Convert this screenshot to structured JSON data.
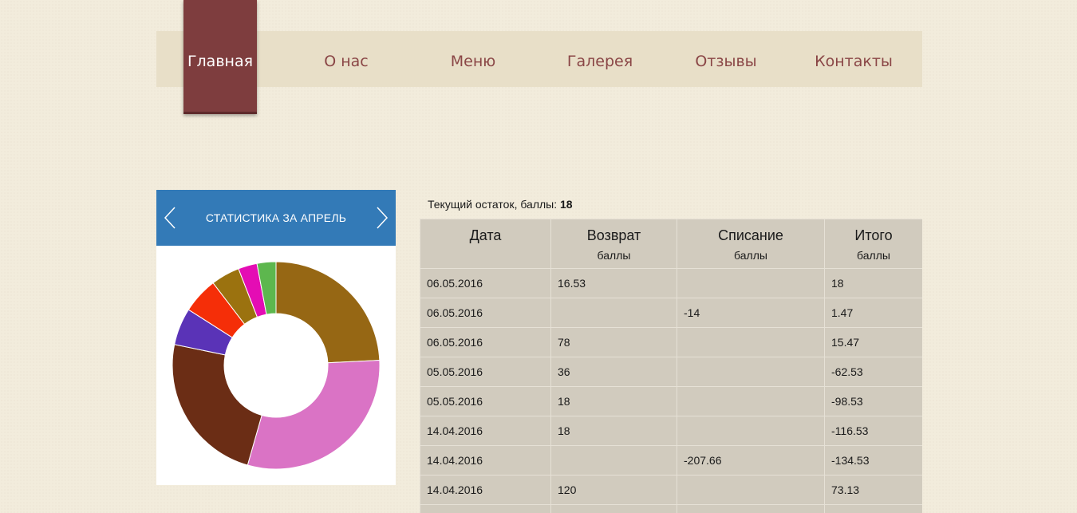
{
  "nav": {
    "items": [
      {
        "label": "Главная",
        "active": true
      },
      {
        "label": "О нас"
      },
      {
        "label": "Меню"
      },
      {
        "label": "Галерея"
      },
      {
        "label": "Отзывы"
      },
      {
        "label": "Контакты"
      }
    ]
  },
  "stats": {
    "title": "СТАТИСТИКА ЗА АПРЕЛЬ",
    "prev_icon": "chevron-left-icon",
    "next_icon": "chevron-right-icon"
  },
  "chart_data": {
    "type": "pie",
    "donut": true,
    "values": [
      23.8,
      29.7,
      23.4,
      5.7,
      5.5,
      4.4,
      2.9,
      2.9
    ],
    "colors": [
      "#966714",
      "#da73c5",
      "#6b2d15",
      "#5a33b7",
      "#f52e08",
      "#9b720f",
      "#e40db4",
      "#5db74e"
    ]
  },
  "balance": {
    "label": "Текущий остаток, баллы:",
    "value": "18"
  },
  "table": {
    "columns": [
      {
        "title": "Дата",
        "sub": ""
      },
      {
        "title": "Возврат",
        "sub": "баллы"
      },
      {
        "title": "Списание",
        "sub": "баллы"
      },
      {
        "title": "Итого",
        "sub": "баллы"
      }
    ],
    "rows": [
      [
        "06.05.2016",
        "16.53",
        "",
        "18"
      ],
      [
        "06.05.2016",
        "",
        "-14",
        "1.47"
      ],
      [
        "06.05.2016",
        "78",
        "",
        "15.47"
      ],
      [
        "05.05.2016",
        "36",
        "",
        "-62.53"
      ],
      [
        "05.05.2016",
        "18",
        "",
        "-98.53"
      ],
      [
        "14.04.2016",
        "18",
        "",
        "-116.53"
      ],
      [
        "14.04.2016",
        "",
        "-207.66",
        "-134.53"
      ],
      [
        "14.04.2016",
        "120",
        "",
        "73.13"
      ],
      [
        "",
        "",
        "",
        ""
      ]
    ]
  }
}
